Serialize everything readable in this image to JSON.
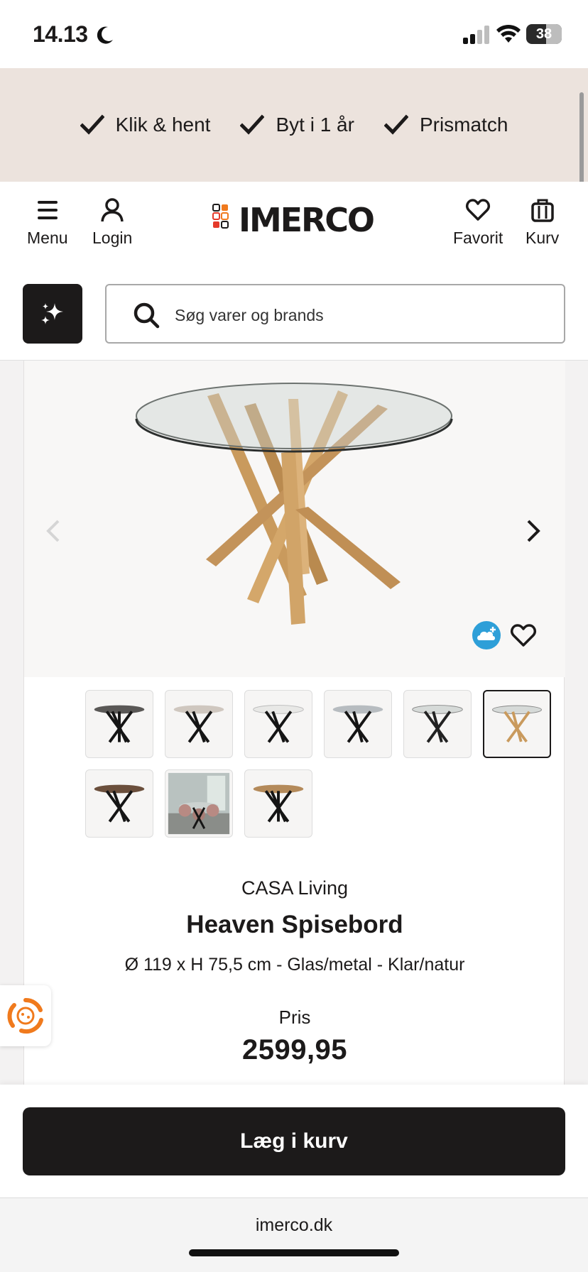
{
  "status_bar": {
    "time": "14.13",
    "battery": "38"
  },
  "usp_bar": {
    "items": [
      {
        "label": "Klik & hent",
        "icon": "check-icon"
      },
      {
        "label": "Byt i 1 år",
        "icon": "check-icon"
      },
      {
        "label": "Prismatch",
        "icon": "check-icon"
      }
    ]
  },
  "header": {
    "menu_label": "Menu",
    "login_label": "Login",
    "logo_text": "IMERCO",
    "favorite_label": "Favorit",
    "cart_label": "Kurv"
  },
  "search": {
    "placeholder": "Søg varer og brands"
  },
  "product": {
    "brand": "CASA Living",
    "name": "Heaven Spisebord",
    "description": "Ø 119 x H 75,5 cm - Glas/metal - Klar/natur",
    "price_label": "Pris",
    "price": "2599,95"
  },
  "gallery": {
    "thumbnails": [
      {
        "variant": "dark-top-black-legs"
      },
      {
        "variant": "beige-top-black-legs"
      },
      {
        "variant": "white-top-black-legs"
      },
      {
        "variant": "grey-glass-black-legs"
      },
      {
        "variant": "clear-glass-black-legs"
      },
      {
        "variant": "clear-glass-natural-legs",
        "selected": true
      },
      {
        "variant": "walnut-top-black-legs"
      },
      {
        "variant": "room-photo"
      },
      {
        "variant": "oak-top-black-legs"
      }
    ]
  },
  "cart": {
    "button_label": "Læg i kurv"
  },
  "browser": {
    "url": "imerco.dk"
  },
  "colors": {
    "primary": "#1c1a1a",
    "usp_bg": "#ece3dd",
    "accent_orange": "#f07a1d",
    "cloud_blue": "#2e9fd8"
  }
}
